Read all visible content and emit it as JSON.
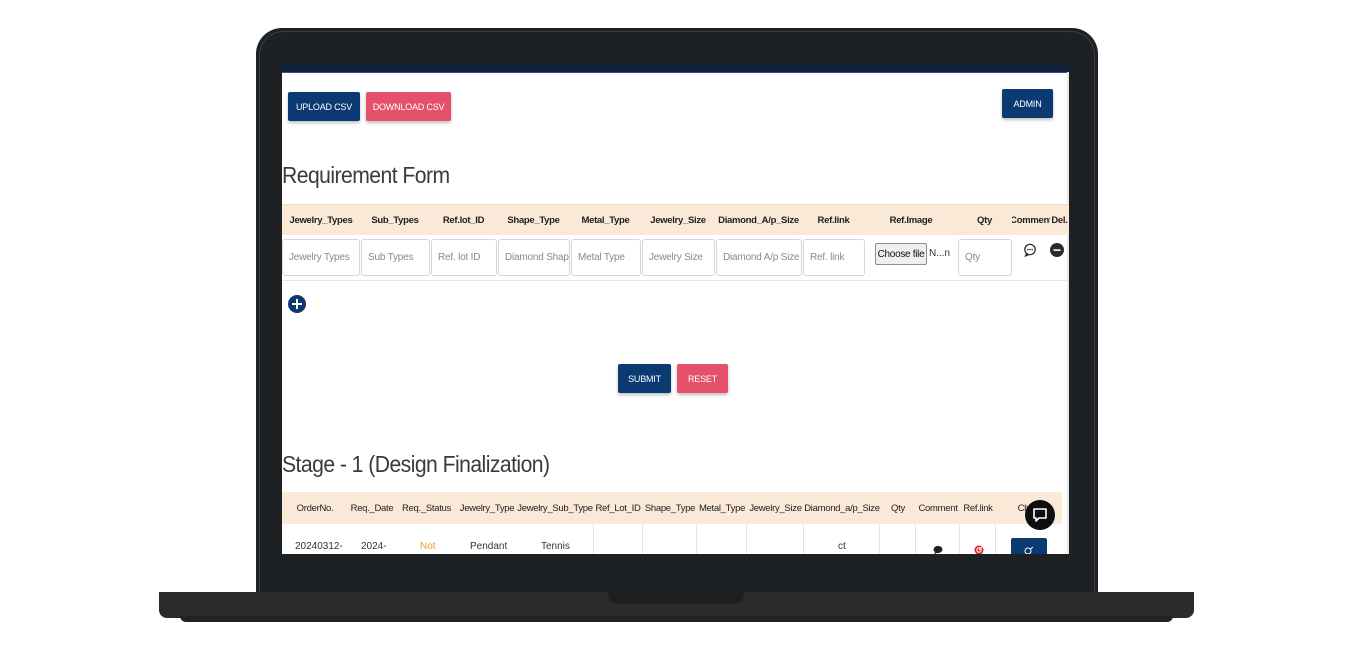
{
  "toolbar": {
    "upload_label": "UPLOAD CSV",
    "download_label": "DOWNLOAD CSV",
    "admin_label": "ADMIN"
  },
  "requirement_form": {
    "title": "Requirement Form",
    "columns": [
      "Jewelry_Types",
      "Sub_Types",
      "Ref.lot_ID",
      "Shape_Type",
      "Metal_Type",
      "Jewelry_Size",
      "Diamond_A/p_Size",
      "Ref.link",
      "Ref.Image",
      "Qty",
      "Comment",
      "Del."
    ],
    "placeholders": {
      "jewelry_types": "Jewelry Types",
      "sub_types": "Sub Types",
      "ref_lot_id": "Ref. lot ID",
      "shape_type": "Diamond Shape",
      "metal_type": "Metal Type",
      "jewelry_size": "Jewelry Size",
      "diamond_size": "Diamond A/p Size",
      "ref_link": "Ref. link",
      "qty": "Qty"
    },
    "file_button": "Choose file",
    "file_status": "N...n",
    "submit_label": "SUBMIT",
    "reset_label": "RESET"
  },
  "stage1": {
    "title": "Stage - 1 (Design Finalization)",
    "columns": [
      "OrderNo.",
      "Req._Date",
      "Req._Status",
      "Jewelry_Type",
      "Jewelry_Sub_Type",
      "Ref_Lot_ID",
      "Shape_Type",
      "Metal_Type",
      "Jewelry_Size",
      "Diamond_a/p_Size",
      "Qty",
      "Comment",
      "Ref.link",
      "Chat"
    ],
    "first_row": {
      "order_no": "20240312-",
      "req_date": "2024-",
      "req_status": "Not",
      "jewelry_type": "Pendant",
      "jewelry_sub_type": "Tennis",
      "diamond_size": "ct"
    }
  },
  "colors": {
    "navy": "#0b3a73",
    "pink": "#e5506b",
    "header_bg": "#fbe9d7",
    "status_color": "#f0a020",
    "link_icon_red": "#e02020"
  }
}
